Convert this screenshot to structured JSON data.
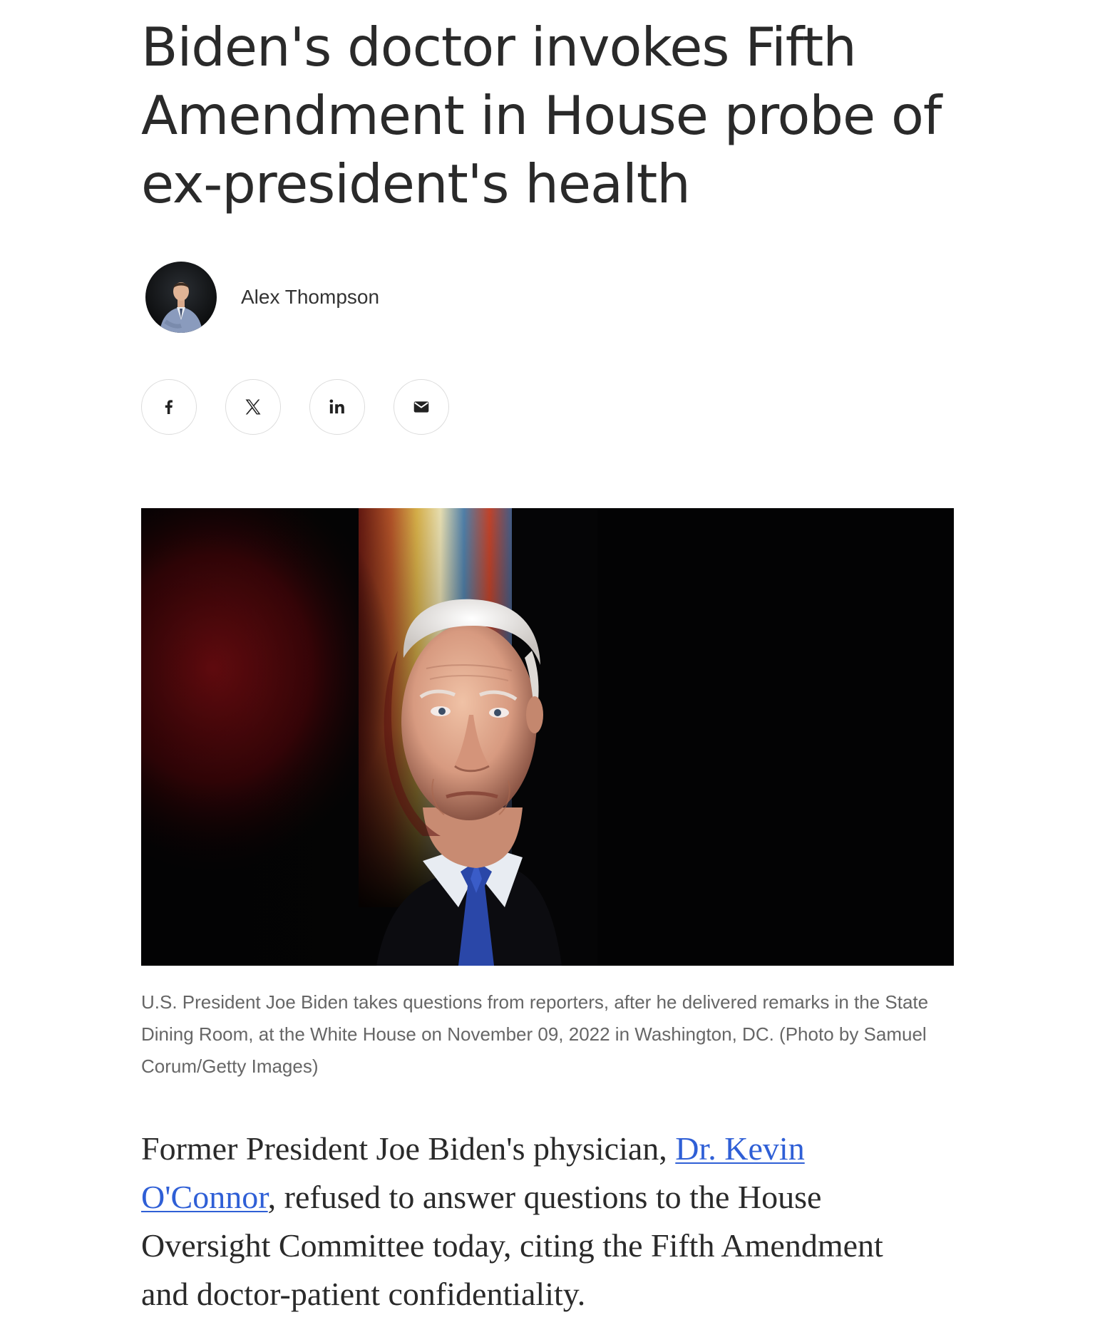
{
  "article": {
    "headline": "Biden's doctor invokes Fifth Amendment in House probe of ex-president's health",
    "author": {
      "name": "Alex Thompson"
    },
    "share": [
      {
        "name": "share-facebook-button",
        "icon": "facebook-icon"
      },
      {
        "name": "share-x-button",
        "icon": "x-icon"
      },
      {
        "name": "share-linkedin-button",
        "icon": "linkedin-icon"
      },
      {
        "name": "share-email-button",
        "icon": "email-icon"
      }
    ],
    "hero_image": {
      "caption": "U.S. President Joe Biden takes questions from reporters, after he delivered remarks in the State Dining Room, at the White House on November 09, 2022 in Washington, DC. (Photo by Samuel Corum/Getty Images)"
    },
    "body": {
      "before_link": "Former President Joe Biden's physician, ",
      "link_text": "Dr. Kevin O'Connor",
      "after_link": ", refused to answer questions to the House Oversight Committee today, citing the Fifth Amendment and doctor-patient confidentiality."
    }
  },
  "colors": {
    "headline": "#2a2a2a",
    "caption": "#666666",
    "link": "#2f5fd6",
    "share_border": "#dcdcdc"
  }
}
